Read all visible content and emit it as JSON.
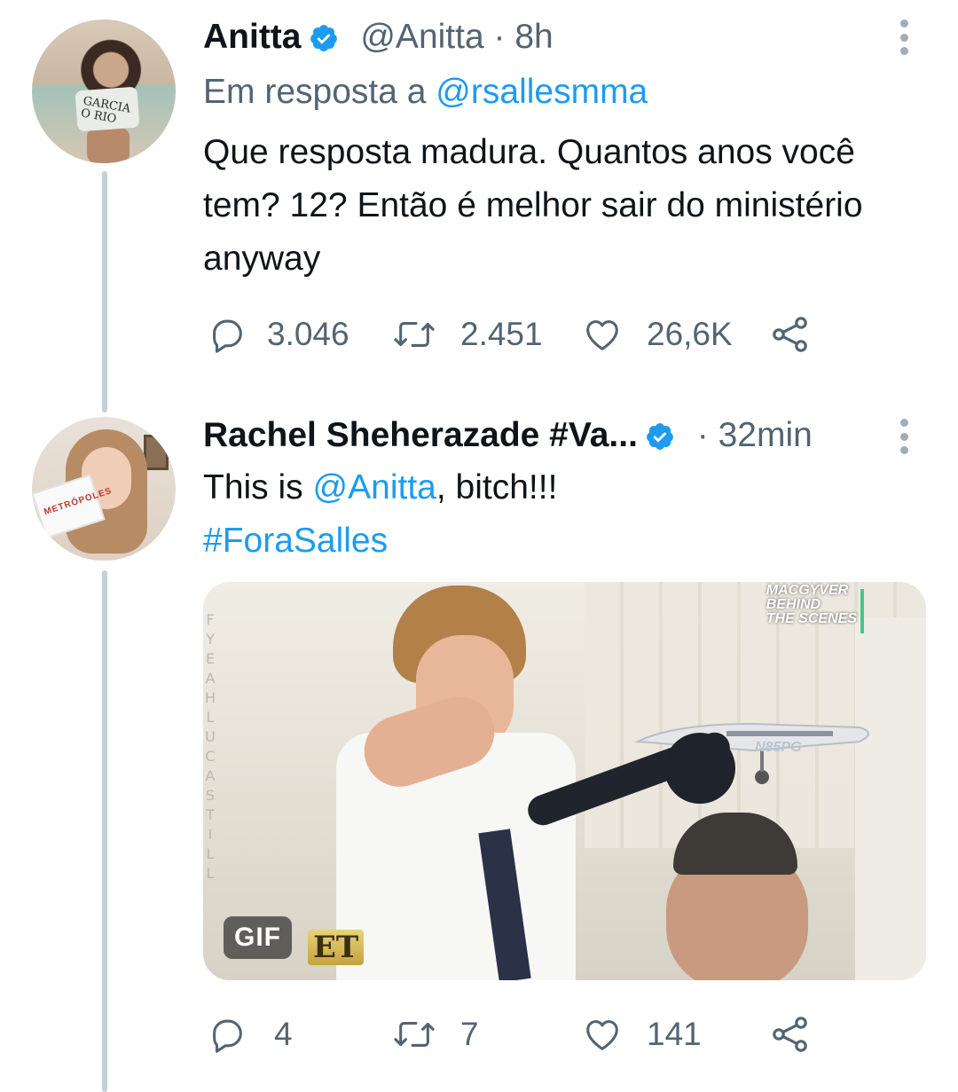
{
  "tweets": [
    {
      "author_name": "Anitta",
      "handle": "@Anitta",
      "separator": "·",
      "time": "8h",
      "reply_prefix": "Em resposta a",
      "reply_to": "@rsallesmma",
      "text": "Que resposta madura. Quantos anos você tem? 12? Então é melhor sair do ministério anyway",
      "avatar_shirt_text": "GARCIA\nO RIO",
      "stats": {
        "replies": "3.046",
        "retweets": "2.451",
        "likes": "26,6K"
      }
    },
    {
      "author_name": "Rachel Sheherazade #Va...",
      "separator": "·",
      "time": "32min",
      "text_prefix": "This is",
      "mention": "@Anitta",
      "text_suffix": ", bitch!!!",
      "hashtag": "#ForaSalles",
      "avatar_card_text": "METRÓPOLES",
      "media": {
        "type": "gif",
        "badge": "GIF",
        "side_letters": "F Y E A H L U C A S T I L L",
        "watermark": "MACGYVER\nBEHIND\nTHE SCENES",
        "tail_number": "N85PG",
        "logo": "ET"
      },
      "stats": {
        "replies": "4",
        "retweets": "7",
        "likes": "141"
      }
    }
  ],
  "colors": {
    "link": "#1d9bf0",
    "secondary_text": "#536471",
    "verified": "#1d9bf0",
    "thread_line": "#c4cfd6"
  },
  "icons": [
    "verified-badge-icon",
    "more-options-icon",
    "reply-icon",
    "retweet-icon",
    "like-icon",
    "share-icon"
  ]
}
